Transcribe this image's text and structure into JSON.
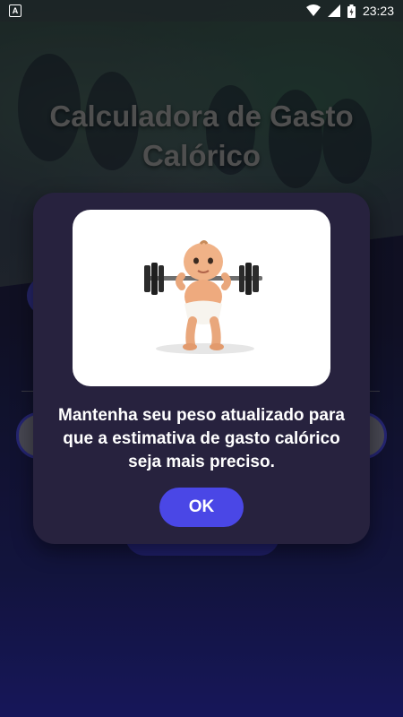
{
  "status_bar": {
    "notification_icon": "A",
    "time": "23:23",
    "icons": [
      "wifi-icon",
      "signal-icon",
      "battery-icon"
    ]
  },
  "app": {
    "title": "Calculadora de Gasto Calórico"
  },
  "dialog": {
    "image_icon": "baby-weightlifter-illustration",
    "message": "Mantenha seu peso atualizado para que a estimativa de gasto calórico seja mais preciso.",
    "ok_label": "OK"
  },
  "colors": {
    "dialog_bg": "#27223e",
    "button": "#4a47e6",
    "background_bottom": "#23238a"
  }
}
